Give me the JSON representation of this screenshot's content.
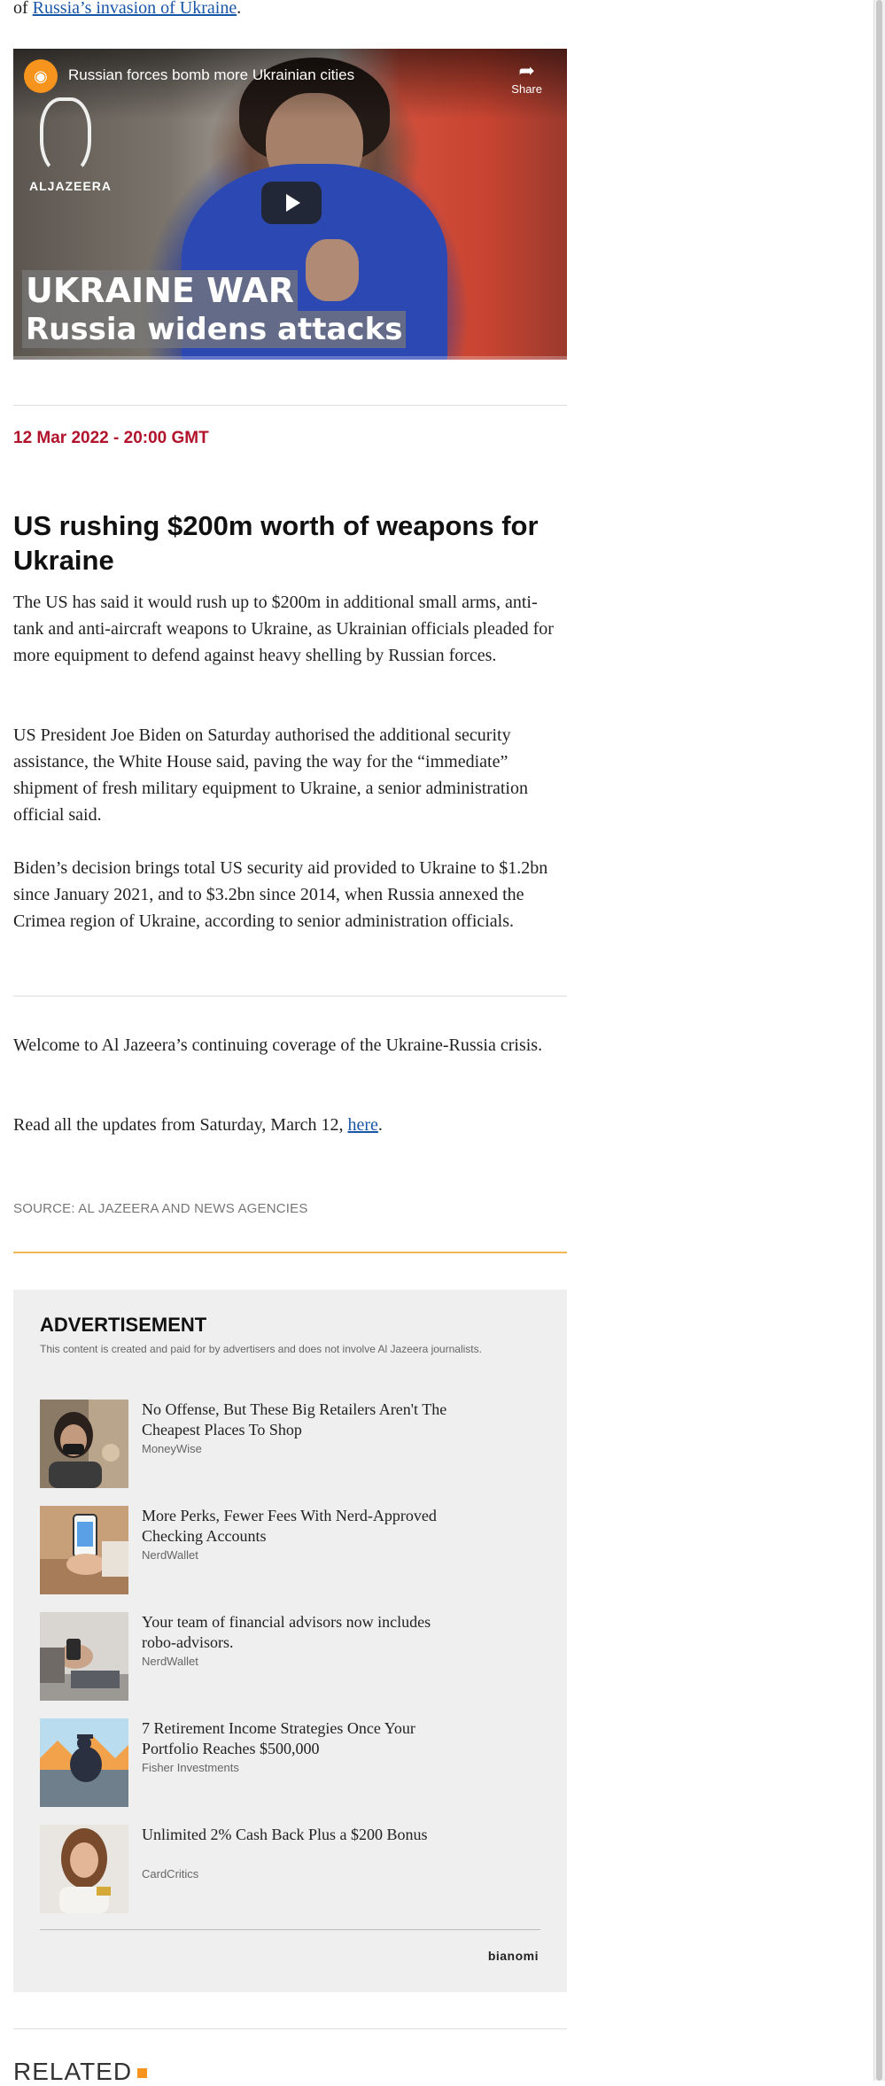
{
  "intro": {
    "prefix": "of ",
    "link_text": "Russia’s invasion of Ukraine",
    "suffix": "."
  },
  "video": {
    "title": "Russian forces bomb more Ukrainian cities",
    "share_label": "Share",
    "logo_text": "ALJAZEERA",
    "banner_line1": "UKRAINE WAR",
    "banner_line2": "Russia widens attacks",
    "share_icon": "share-arrow-icon",
    "play_icon": "play-icon"
  },
  "update": {
    "timestamp": "12 Mar 2022 - 20:00 GMT",
    "headline": "US rushing $200m worth of weapons for Ukraine",
    "paragraphs": [
      "The US has said it would rush up to $200m in additional small arms, anti-tank and anti-aircraft weapons to Ukraine, as Ukrainian officials pleaded for more equipment to defend against heavy shelling by Russian forces.",
      "US President Joe Biden on Saturday authorised the additional security assistance, the White House said, paving the way for the “immediate” shipment of fresh military equipment to Ukraine, a senior administration official said.",
      "Biden’s decision brings total US security aid provided to Ukraine to $1.2bn since January 2021, and to $3.2bn since 2014, when Russia annexed the Crimea region of Ukraine, according to senior administration officials."
    ]
  },
  "welcome": {
    "text": "Welcome to Al Jazeera’s continuing coverage of the Ukraine-Russia crisis.",
    "read_prefix": "Read all the updates from Saturday, March 12, ",
    "read_link": "here",
    "read_suffix": "."
  },
  "source": "SOURCE: AL JAZEERA AND NEWS AGENCIES",
  "advertisement": {
    "title": "ADVERTISEMENT",
    "disclaimer": "This content is created and paid for by advertisers and does not involve Al Jazeera journalists.",
    "items": [
      {
        "headline": "No Offense, But These Big Retailers Aren't The Cheapest Places To Shop",
        "brand": "MoneyWise"
      },
      {
        "headline": "More Perks, Fewer Fees With Nerd-Approved Checking Accounts",
        "brand": "NerdWallet"
      },
      {
        "headline": "Your team of financial advisors now includes robo-advisors.",
        "brand": "NerdWallet"
      },
      {
        "headline": "7 Retirement Income Strategies Once Your Portfolio Reaches $500,000",
        "brand": "Fisher Investments"
      },
      {
        "headline": "Unlimited 2% Cash Back Plus a $200 Bonus",
        "brand": "CardCritics"
      }
    ],
    "provider": "bianomi"
  },
  "related": {
    "heading": "RELATED"
  },
  "colors": {
    "timestamp_red": "#b0132b",
    "link_blue": "#1a56a8",
    "accent_orange": "#f7941d",
    "ad_background": "#efefef"
  }
}
